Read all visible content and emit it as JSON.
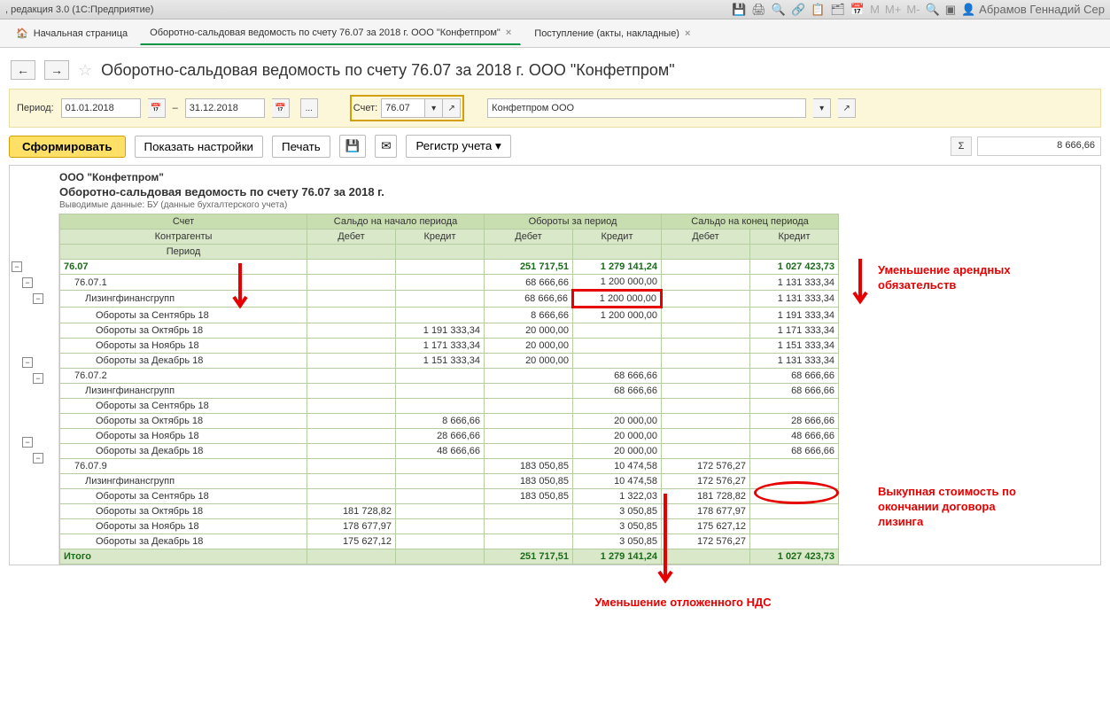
{
  "titlebar": {
    "text": ", редакция 3.0 (1С:Предприятие)",
    "user": "Абрамов Геннадий Сер"
  },
  "tabs": {
    "home": "Начальная страница",
    "tab1": "Оборотно-сальдовая ведомость по счету 76.07 за 2018 г. ООО \"Конфетпром\"",
    "tab2": "Поступление (акты, накладные)"
  },
  "page": {
    "title": "Оборотно-сальдовая ведомость по счету 76.07 за 2018 г. ООО \"Конфетпром\""
  },
  "filter": {
    "period_label": "Период:",
    "date_from": "01.01.2018",
    "date_to": "31.12.2018",
    "dash": "–",
    "more": "...",
    "acct_label": "Счет:",
    "acct_value": "76.07",
    "org_value": "Конфетпром ООО"
  },
  "toolbar": {
    "generate": "Сформировать",
    "settings": "Показать настройки",
    "print": "Печать",
    "register": "Регистр учета"
  },
  "sum": {
    "symbol": "Σ",
    "value": "8 666,66"
  },
  "report": {
    "org": "ООО \"Конфетпром\"",
    "title": "Оборотно-сальдовая ведомость по счету 76.07 за 2018 г.",
    "sub": "Выводимые данные: БУ (данные бухгалтерского учета)",
    "headers": {
      "acct": "Счет",
      "counter": "Контрагенты",
      "period": "Период",
      "start": "Сальдо на начало периода",
      "turn": "Обороты за период",
      "end": "Сальдо на конец периода",
      "debit": "Дебет",
      "credit": "Кредит"
    },
    "rows": [
      {
        "lvl": 0,
        "label": "76.07",
        "sd": "",
        "sc": "",
        "td": "251 717,51",
        "tc": "1 279 141,24",
        "ed": "",
        "ec": "1 027 423,73"
      },
      {
        "lvl": 1,
        "label": "76.07.1",
        "sd": "",
        "sc": "",
        "td": "68 666,66",
        "tc": "1 200 000,00",
        "ed": "",
        "ec": "1 131 333,34"
      },
      {
        "lvl": 2,
        "label": "Лизингфинансгрупп",
        "sd": "",
        "sc": "",
        "td": "68 666,66",
        "tc": "1 200 000,00",
        "ed": "",
        "ec": "1 131 333,34",
        "hl": true
      },
      {
        "lvl": 3,
        "label": "Обороты за Сентябрь 18",
        "sd": "",
        "sc": "",
        "td": "8 666,66",
        "tc": "1 200 000,00",
        "ed": "",
        "ec": "1 191 333,34"
      },
      {
        "lvl": 3,
        "label": "Обороты за Октябрь 18",
        "sd": "",
        "sc": "1 191 333,34",
        "td": "20 000,00",
        "tc": "",
        "ed": "",
        "ec": "1 171 333,34"
      },
      {
        "lvl": 3,
        "label": "Обороты за Ноябрь 18",
        "sd": "",
        "sc": "1 171 333,34",
        "td": "20 000,00",
        "tc": "",
        "ed": "",
        "ec": "1 151 333,34"
      },
      {
        "lvl": 3,
        "label": "Обороты за Декабрь 18",
        "sd": "",
        "sc": "1 151 333,34",
        "td": "20 000,00",
        "tc": "",
        "ed": "",
        "ec": "1 131 333,34"
      },
      {
        "lvl": 1,
        "label": "76.07.2",
        "sd": "",
        "sc": "",
        "td": "",
        "tc": "68 666,66",
        "ed": "",
        "ec": "68 666,66"
      },
      {
        "lvl": 2,
        "label": "Лизингфинансгрупп",
        "sd": "",
        "sc": "",
        "td": "",
        "tc": "68 666,66",
        "ed": "",
        "ec": "68 666,66"
      },
      {
        "lvl": 3,
        "label": "Обороты за Сентябрь 18",
        "sd": "",
        "sc": "",
        "td": "",
        "tc": "",
        "ed": "",
        "ec": ""
      },
      {
        "lvl": 3,
        "label": "Обороты за Октябрь 18",
        "sd": "",
        "sc": "8 666,66",
        "td": "",
        "tc": "20 000,00",
        "ed": "",
        "ec": "28 666,66"
      },
      {
        "lvl": 3,
        "label": "Обороты за Ноябрь 18",
        "sd": "",
        "sc": "28 666,66",
        "td": "",
        "tc": "20 000,00",
        "ed": "",
        "ec": "48 666,66"
      },
      {
        "lvl": 3,
        "label": "Обороты за Декабрь 18",
        "sd": "",
        "sc": "48 666,66",
        "td": "",
        "tc": "20 000,00",
        "ed": "",
        "ec": "68 666,66"
      },
      {
        "lvl": 1,
        "label": "76.07.9",
        "sd": "",
        "sc": "",
        "td": "183 050,85",
        "tc": "10 474,58",
        "ed": "172 576,27",
        "ec": ""
      },
      {
        "lvl": 2,
        "label": "Лизингфинансгрупп",
        "sd": "",
        "sc": "",
        "td": "183 050,85",
        "tc": "10 474,58",
        "ed": "172 576,27",
        "ec": ""
      },
      {
        "lvl": 3,
        "label": "Обороты за Сентябрь 18",
        "sd": "",
        "sc": "",
        "td": "183 050,85",
        "tc": "1 322,03",
        "ed": "181 728,82",
        "ec": ""
      },
      {
        "lvl": 3,
        "label": "Обороты за Октябрь 18",
        "sd": "181 728,82",
        "sc": "",
        "td": "",
        "tc": "3 050,85",
        "ed": "178 677,97",
        "ec": ""
      },
      {
        "lvl": 3,
        "label": "Обороты за Ноябрь 18",
        "sd": "178 677,97",
        "sc": "",
        "td": "",
        "tc": "3 050,85",
        "ed": "175 627,12",
        "ec": ""
      },
      {
        "lvl": 3,
        "label": "Обороты за Декабрь 18",
        "sd": "175 627,12",
        "sc": "",
        "td": "",
        "tc": "3 050,85",
        "ed": "172 576,27",
        "ec": ""
      }
    ],
    "total_label": "Итого",
    "total": {
      "sd": "",
      "sc": "",
      "td": "251 717,51",
      "tc": "1 279 141,24",
      "ed": "",
      "ec": "1 027 423,73"
    }
  },
  "annotations": {
    "a1": "Уменьшение арендных обязательств",
    "a2": "Выкупная стоимость по окончании договора лизинга",
    "a3": "Уменьшение отложенного НДС"
  }
}
